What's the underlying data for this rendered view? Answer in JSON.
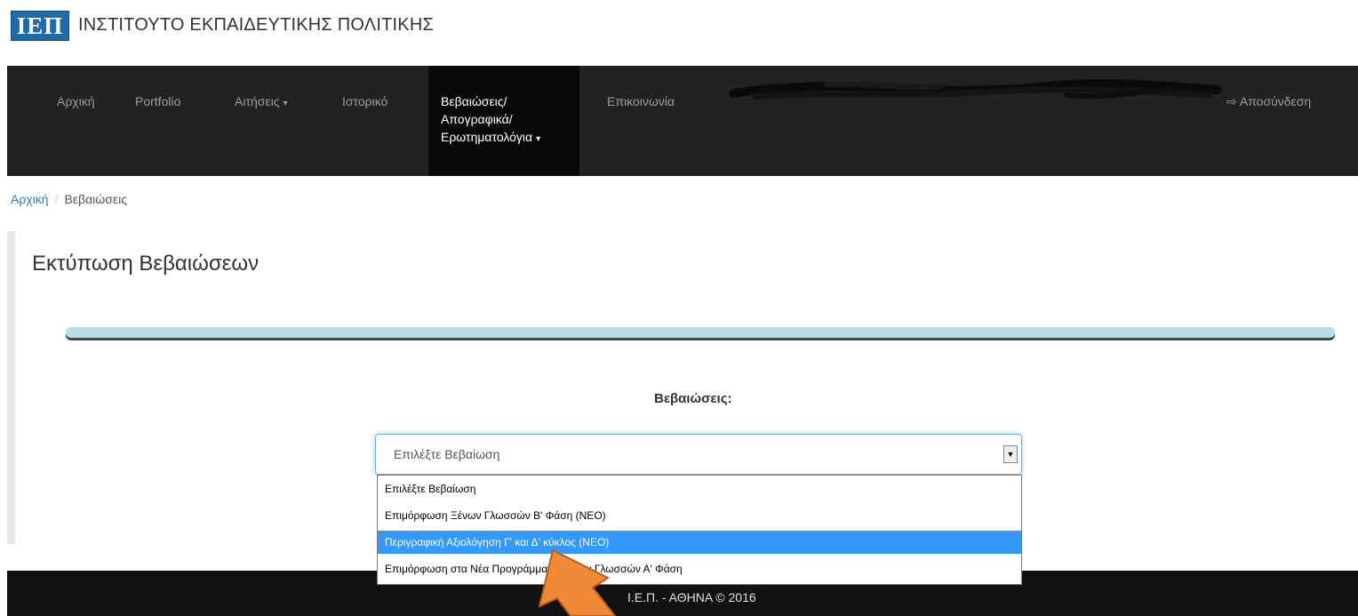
{
  "header": {
    "logo": "ΙΕΠ",
    "org_name": "ΙΝΣΤΙΤΟΥΤΟ ΕΚΠΑΙΔΕΥΤΙΚΗΣ ΠΟΛΙΤΙΚΗΣ"
  },
  "navbar": {
    "items": [
      {
        "label": "Αρχική"
      },
      {
        "label": "Portfolio"
      },
      {
        "label": "Αιτήσεις"
      },
      {
        "label": "Ιστορικό"
      },
      {
        "label": "Επικοινωνία"
      }
    ],
    "active": {
      "line1": "Βεβαιώσεις/",
      "line2": "Απογραφικά/",
      "line3": "Ερωτηματολόγια"
    },
    "logout": "Αποσύνδεση"
  },
  "breadcrumb": {
    "home": "Αρχική",
    "separator": "/",
    "current": "Βεβαιώσεις"
  },
  "main": {
    "title": "Εκτύπωση Βεβαιώσεων",
    "field_label": "Βεβαιώσεις:",
    "select": {
      "value": "Επιλέξτε Βεβαίωση",
      "options": [
        "Επιλέξτε Βεβαίωση",
        "Επιμόρφωση Ξένων Γλωσσών Β' Φάση (ΝΕΟ)",
        "Περιγραφική Αξιολόγηση Γ' και Δ' κύκλος (ΝΕΟ)",
        "Επιμόρφωση στα Νέα Προγράμματα Ξένων Γλωσσών Α' Φάση"
      ],
      "highlighted_index": 2
    }
  },
  "footer": {
    "text": "Ι.Ε.Π. - ΑΘΗΝΑ © 2016"
  },
  "colors": {
    "navbar_bg": "#222222",
    "active_bg": "#080808",
    "link": "#337ab7",
    "highlight": "#3399ff",
    "divider": "#b7dde5",
    "arrow": "#f08a38"
  }
}
